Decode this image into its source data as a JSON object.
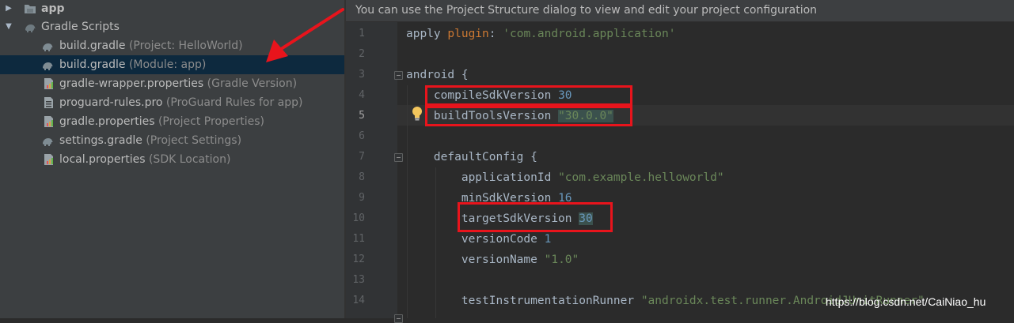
{
  "tree": {
    "items": [
      {
        "name": "app",
        "hint": "",
        "icon": "folder-icon",
        "expander": "▶"
      },
      {
        "name": "Gradle Scripts",
        "hint": "",
        "icon": "gradle-elephant-icon",
        "expander": "▼"
      },
      {
        "name": "build.gradle",
        "hint": "(Project: HelloWorld)",
        "icon": "gradle-elephant-icon"
      },
      {
        "name": "build.gradle",
        "hint": "(Module: app)",
        "icon": "gradle-elephant-icon"
      },
      {
        "name": "gradle-wrapper.properties",
        "hint": "(Gradle Version)",
        "icon": "properties-file-icon"
      },
      {
        "name": "proguard-rules.pro",
        "hint": "(ProGuard Rules for app)",
        "icon": "text-file-icon"
      },
      {
        "name": "gradle.properties",
        "hint": "(Project Properties)",
        "icon": "properties-file-icon"
      },
      {
        "name": "settings.gradle",
        "hint": "(Project Settings)",
        "icon": "gradle-elephant-icon"
      },
      {
        "name": "local.properties",
        "hint": "(SDK Location)",
        "icon": "properties-file-icon"
      }
    ],
    "selected_index": 3
  },
  "editor": {
    "banner": "You can use the Project Structure dialog to view and edit your project configuration",
    "current_line": 5,
    "lines": [
      {
        "n": "1",
        "parts": [
          [
            "apply ",
            "plain"
          ],
          [
            "plugin",
            "kw"
          ],
          [
            ": ",
            "plain"
          ],
          [
            "'com.android.application'",
            "str"
          ]
        ]
      },
      {
        "n": "2",
        "parts": []
      },
      {
        "n": "3",
        "parts": [
          [
            "android {",
            "plain"
          ]
        ]
      },
      {
        "n": "4",
        "parts": [
          [
            "    compileSdkVersion ",
            "plain"
          ],
          [
            "30",
            "num"
          ]
        ]
      },
      {
        "n": "5",
        "parts": [
          [
            "    buildToolsVersion ",
            "plain"
          ],
          [
            "\"30.0.0\"",
            "str-hl"
          ]
        ]
      },
      {
        "n": "6",
        "parts": []
      },
      {
        "n": "7",
        "parts": [
          [
            "    defaultConfig {",
            "plain"
          ]
        ]
      },
      {
        "n": "8",
        "parts": [
          [
            "        applicationId ",
            "plain"
          ],
          [
            "\"com.example.helloworld\"",
            "str"
          ]
        ]
      },
      {
        "n": "9",
        "parts": [
          [
            "        minSdkVersion ",
            "plain"
          ],
          [
            "16",
            "num"
          ]
        ]
      },
      {
        "n": "10",
        "parts": [
          [
            "        targetSdkVersion ",
            "plain"
          ],
          [
            "30",
            "num-hl"
          ]
        ]
      },
      {
        "n": "11",
        "parts": [
          [
            "        versionCode ",
            "plain"
          ],
          [
            "1",
            "num"
          ]
        ]
      },
      {
        "n": "12",
        "parts": [
          [
            "        versionName ",
            "plain"
          ],
          [
            "\"1.0\"",
            "str"
          ]
        ]
      },
      {
        "n": "13",
        "parts": []
      },
      {
        "n": "14",
        "parts": [
          [
            "        testInstrumentationRunner ",
            "plain"
          ],
          [
            "\"androidx.test.runner.AndroidJUnitRunner\"",
            "str"
          ]
        ]
      }
    ]
  },
  "watermark": "https://blog.csdn.net/CaiNiao_hu",
  "colors": {
    "accent_red": "#e8141c",
    "selection": "#0d293e",
    "keyword": "#cc7832",
    "string": "#6a8759",
    "number": "#6897bb"
  }
}
